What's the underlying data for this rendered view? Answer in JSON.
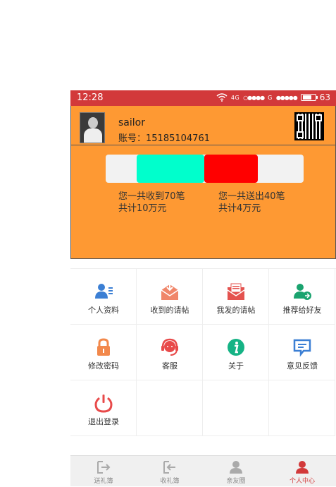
{
  "status": {
    "time": "12:28",
    "network": "4G",
    "carrier": "G",
    "signal_dots_1": "○●●●●",
    "signal_dots_2": "●●●●●",
    "battery": "63"
  },
  "profile": {
    "username": "sailor",
    "account": "账号：15185104761"
  },
  "stats": {
    "received_line1": "您一共收到70笔",
    "received_line2": "共计10万元",
    "sent_line1": "您一共送出40笔",
    "sent_line2": "共计4万元"
  },
  "menu": {
    "items": [
      {
        "label": "个人资料",
        "icon": "person-card-icon",
        "color": "#3b7fd4"
      },
      {
        "label": "收到的请帖",
        "icon": "inbox-envelope-icon",
        "color": "#f0866a"
      },
      {
        "label": "我发的请帖",
        "icon": "outbox-envelope-icon",
        "color": "#e4534f"
      },
      {
        "label": "推荐给好友",
        "icon": "share-user-icon",
        "color": "#1aa36f"
      },
      {
        "label": "修改密码",
        "icon": "lock-icon",
        "color": "#f2884b"
      },
      {
        "label": "客服",
        "icon": "headset-icon",
        "color": "#e84a4a"
      },
      {
        "label": "关于",
        "icon": "info-icon",
        "color": "#15b385"
      },
      {
        "label": "意见反馈",
        "icon": "feedback-icon",
        "color": "#3b7fd4"
      },
      {
        "label": "退出登录",
        "icon": "power-icon",
        "color": "#e84a4a"
      }
    ]
  },
  "tabs": [
    {
      "label": "送礼簿",
      "icon": "send-gift-icon"
    },
    {
      "label": "收礼簿",
      "icon": "receive-gift-icon"
    },
    {
      "label": "亲友圈",
      "icon": "friends-icon"
    },
    {
      "label": "个人中心",
      "icon": "user-center-icon",
      "active": true
    }
  ],
  "colors": {
    "status_bar": "#d2393a",
    "header": "#fe9933",
    "received_bar": "#00ffcc",
    "sent_bar": "#ff0000"
  }
}
